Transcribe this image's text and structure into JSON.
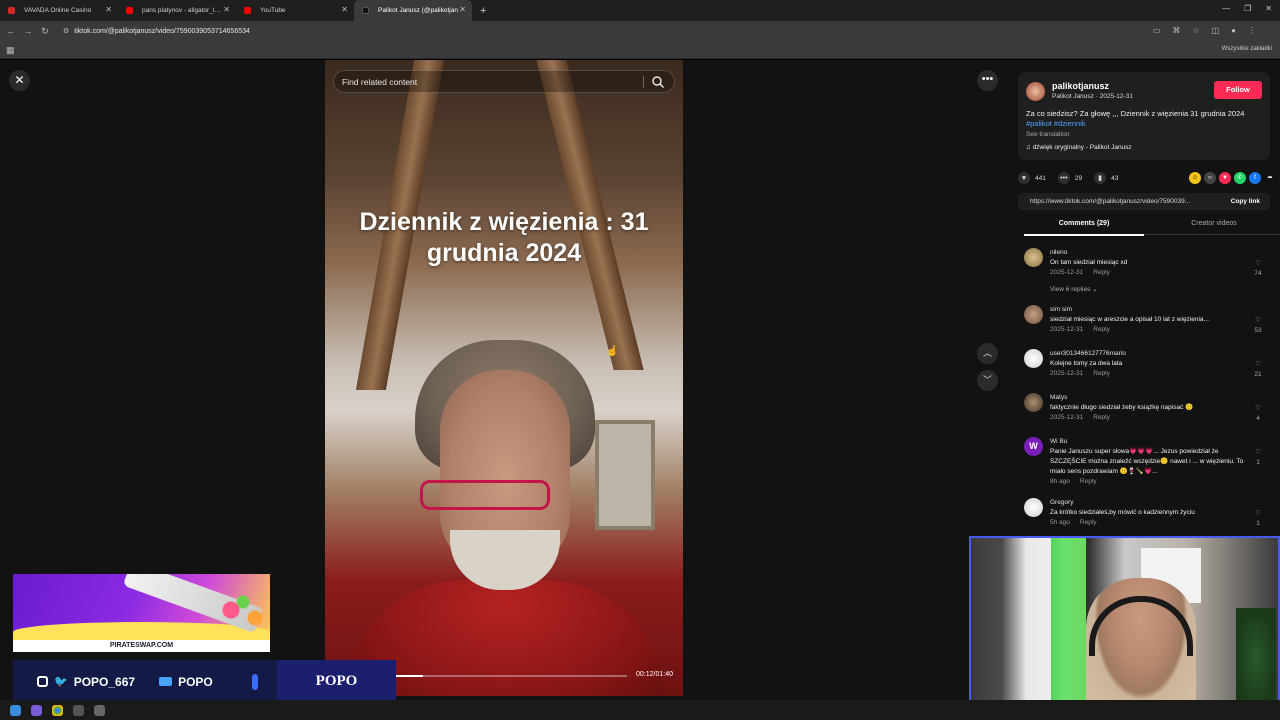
{
  "browser": {
    "tabs": [
      {
        "title": "VAVADA Online Casino",
        "color": "#d42a2a"
      },
      {
        "title": "paris platynov - aligator_lacos",
        "color": "#ff0000"
      },
      {
        "title": "YouTube",
        "color": "#ff0000"
      },
      {
        "title": "Palikot Janusz (@palikotjan",
        "color": "#111111",
        "active": true
      }
    ],
    "url": "tiktok.com/@palikotjanusz/video/7590039053714656534",
    "bookmarks_label": "Wszystkie zakładki"
  },
  "video": {
    "search_placeholder": "Find related content",
    "overlay_title": "Dziennik z więzienia : 31 grudnia 2024",
    "time": "00:12/01:40",
    "progress": 0.12
  },
  "post": {
    "username": "palikotjanusz",
    "subtitle": "Palikot Janusz · 2025-12-31",
    "follow_label": "Follow",
    "caption_text": "Za co siedzisz? Za głowę ,,, Dziennik z więzienia 31 grudnia 2024 ",
    "caption_tags": "#palikot #dziennik",
    "see_translation": "See translation",
    "music": "dźwięk oryginalny - Palikot Janusz",
    "likes": "441",
    "comments_count": "29",
    "saves": "43",
    "link": "https://www.tiktok.com/@palikotjanusz/video/7590039...",
    "copy_link": "Copy link",
    "accent_color": "#fe2c55"
  },
  "panel_tabs": {
    "comments": "Comments (29)",
    "creator": "Creator videos"
  },
  "comments": [
    {
      "name": "nileno",
      "text": "On tam siedział miesiąc xd",
      "date": "2025-12-31",
      "reply": "Reply",
      "likes": "74",
      "replies": "View 6 replies"
    },
    {
      "name": "sim sim",
      "text": "siedział miesiąc w areszcie a opisał 10 lat z więzienia...",
      "date": "2025-12-31",
      "reply": "Reply",
      "likes": "53"
    },
    {
      "name": "user3013466127776mario",
      "text": "Kolejne tomy za dwa lata",
      "date": "2025-12-31",
      "reply": "Reply",
      "likes": "21"
    },
    {
      "name": "Matys",
      "text": "faktycznie długo siedział żeby książkę napisać 🙂",
      "date": "2025-12-31",
      "reply": "Reply",
      "likes": "4"
    },
    {
      "name": "Wi Bu",
      "text": "Panie Januszu super słowa💗💗💗... Jezus powiedział że SZCZĘŚCIE można znaleźć wszędzie🙂 nawet i ... w więzieniu. To miało sens pozdrawiam 🙂🍷🍾💗...",
      "date": "8h ago",
      "reply": "Reply",
      "likes": "1"
    },
    {
      "name": "Gregory",
      "text": "Za krótko siedziałeś,by mówić o kadziennym życiu",
      "date": "5h ago",
      "reply": "Reply",
      "likes": "1"
    }
  ],
  "stream": {
    "ad_brand": "PIRATESWAP.COM",
    "handle1": "POPO_667",
    "handle2": "POPO",
    "badge": "POPO"
  }
}
